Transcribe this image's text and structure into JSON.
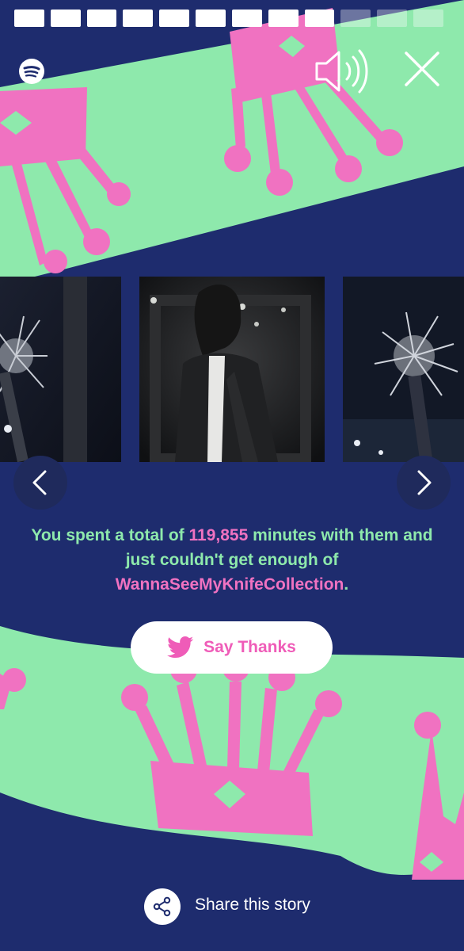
{
  "progress": {
    "total": 12,
    "completed": 9
  },
  "colors": {
    "navy": "#1e2c6e",
    "green": "#8ee9ac",
    "pink": "#f072c1",
    "white": "#ffffff"
  },
  "icons": {
    "brand": "spotify-icon",
    "sound": "speaker-icon",
    "close": "close-icon",
    "prev": "chevron-left-icon",
    "next": "chevron-right-icon",
    "bird": "twitter-icon",
    "share": "share-icon"
  },
  "stat": {
    "prefix": "You spent a total of ",
    "minutes": "119,855",
    "middle": " minutes with them and just couldn't get enough of ",
    "artist": "WannaSeeMyKnifeCollection",
    "suffix": "."
  },
  "say_thanks": {
    "label": "Say Thanks"
  },
  "share": {
    "label": "Share this story"
  }
}
